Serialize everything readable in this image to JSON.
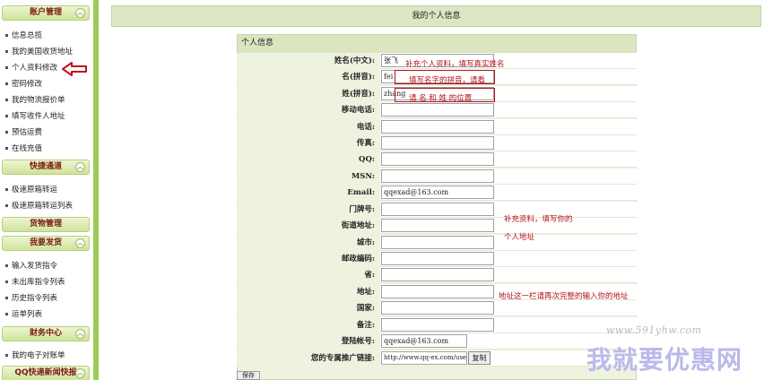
{
  "sidebar": {
    "sections": [
      {
        "title": "账户管理",
        "items": [
          "信息总揽",
          "我的美国收货地址",
          "个人资料修改",
          "密码修改",
          "我的物流报价单",
          "填写收件人地址",
          "预估运费",
          "在线充值"
        ]
      },
      {
        "title": "快捷通道",
        "items": [
          "极速原箱转运",
          "极速原箱转运列表"
        ]
      },
      {
        "title": "货物管理",
        "items": []
      },
      {
        "title": "我要发货",
        "items": [
          "输入发货指令",
          "未出库指令列表",
          "历史指令列表",
          "运单列表"
        ]
      },
      {
        "title": "财务中心",
        "items": [
          "我的电子对账单"
        ]
      },
      {
        "title": "QQ快递新闻快报",
        "items": []
      }
    ]
  },
  "header": {
    "title": "我的个人信息"
  },
  "form": {
    "panel_title": "个人信息",
    "fields": [
      {
        "label": "姓名(中文):",
        "value": "张飞"
      },
      {
        "label": "名(拼音):",
        "value": "fei"
      },
      {
        "label": "姓(拼音):",
        "value": "zhang"
      },
      {
        "label": "移动电话:",
        "value": ""
      },
      {
        "label": "电话:",
        "value": ""
      },
      {
        "label": "传真:",
        "value": ""
      },
      {
        "label": "QQ:",
        "value": ""
      },
      {
        "label": "MSN:",
        "value": ""
      },
      {
        "label": "Email:",
        "value": "qqexad@163.com"
      },
      {
        "label": "门牌号:",
        "value": ""
      },
      {
        "label": "街道地址:",
        "value": ""
      },
      {
        "label": "城市:",
        "value": ""
      },
      {
        "label": "邮政编码:",
        "value": ""
      },
      {
        "label": "省:",
        "value": ""
      },
      {
        "label": "地址:",
        "value": ""
      },
      {
        "label": "国家:",
        "value": ""
      },
      {
        "label": "备注:",
        "value": ""
      },
      {
        "label": "登陆帐号:",
        "value": "qqexad@163.com"
      },
      {
        "label": "您的专属推广链接:",
        "value": "http://www.qq-ex.com/user/?u"
      }
    ],
    "copy_label": "复制",
    "save_label": "保存"
  },
  "annotations": {
    "name": "补充个人资料，填写真实姓名",
    "pinyin1": "填写名字的拼音，请看",
    "pinyin2": "请 名 和 姓 的位置",
    "address1": "补充资料，填写你的",
    "address2": "个人地址",
    "full_address": "地址这一栏请再次完整的输入你的地址"
  },
  "watermark": {
    "url": "www.591yhw.com",
    "text": "我就要优惠网"
  },
  "colors": {
    "sidebar_border": "#9ccb57",
    "annotation_red": "#b0131b",
    "panel_bg": "#eef3df"
  }
}
